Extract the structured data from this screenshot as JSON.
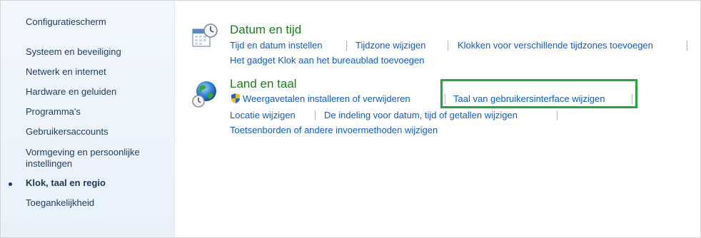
{
  "sidebar": {
    "home_label": "Configuratiescherm",
    "items": [
      {
        "label": "Systeem en beveiliging"
      },
      {
        "label": "Netwerk en internet"
      },
      {
        "label": "Hardware en geluiden"
      },
      {
        "label": "Programma's"
      },
      {
        "label": "Gebruikersaccounts"
      },
      {
        "label": "Vormgeving en persoonlijke instellingen"
      },
      {
        "label": "Klok, taal en regio",
        "current": true
      },
      {
        "label": "Toegankelijkheid"
      }
    ]
  },
  "categories": [
    {
      "title": "Datum en tijd",
      "icon": "calendar-clock-icon",
      "links": [
        "Tijd en datum instellen",
        "Tijdzone wijzigen",
        "Klokken voor verschillende tijdzones toevoegen",
        "Het gadget Klok aan het bureaublad toevoegen"
      ]
    },
    {
      "title": "Land en taal",
      "icon": "globe-clock-icon",
      "shield_icon": "uac-shield-icon",
      "links": [
        "Weergavetalen installeren of verwijderen",
        "Taal van gebruikersinterface wijzigen",
        "Locatie wijzigen",
        "De indeling voor datum, tijd of getallen wijzigen",
        "Toetsenborden of andere invoermethoden wijzigen"
      ]
    }
  ],
  "highlight_color": "#1faa3b"
}
